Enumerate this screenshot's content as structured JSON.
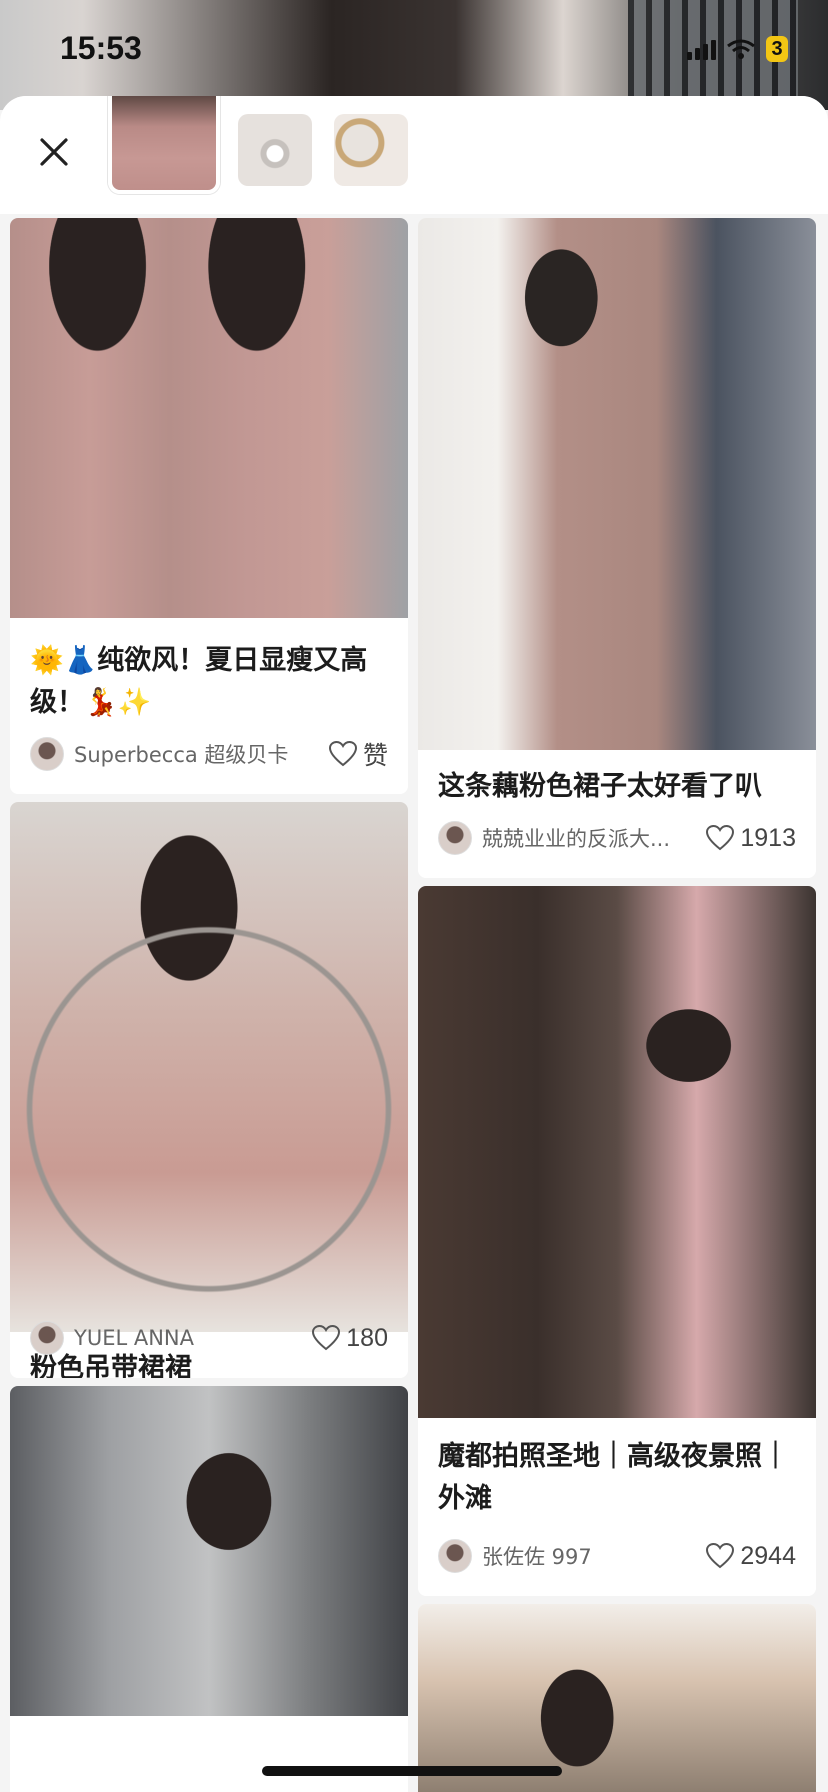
{
  "status_bar": {
    "time": "15:53",
    "battery": "3"
  },
  "header": {
    "close_label": "close",
    "thumbnails": [
      {
        "name": "dress",
        "active": true
      },
      {
        "name": "necklace",
        "active": false
      },
      {
        "name": "bracelet",
        "active": false
      }
    ]
  },
  "feed": {
    "cards": [
      {
        "title": "🌞👗纯欲风！夏日显瘦又高级！💃✨",
        "author": "Superbecca 超级贝卡",
        "likes": "赞"
      },
      {
        "title": "这条藕粉色裙子太好看了叭",
        "author": "兢兢业业的反派大...",
        "likes": "1913"
      },
      {
        "title": "粉色吊带裙裙",
        "author": "YUEL ANNA",
        "likes": "180"
      },
      {
        "title": "魔都拍照圣地｜高级夜景照｜外滩",
        "author": "张佐佐 997",
        "likes": "2944"
      }
    ]
  },
  "colors": {
    "sheet_bg": "#f4f4f4",
    "card_bg": "#ffffff",
    "text": "#1c1c1c",
    "meta_text": "#666666"
  }
}
